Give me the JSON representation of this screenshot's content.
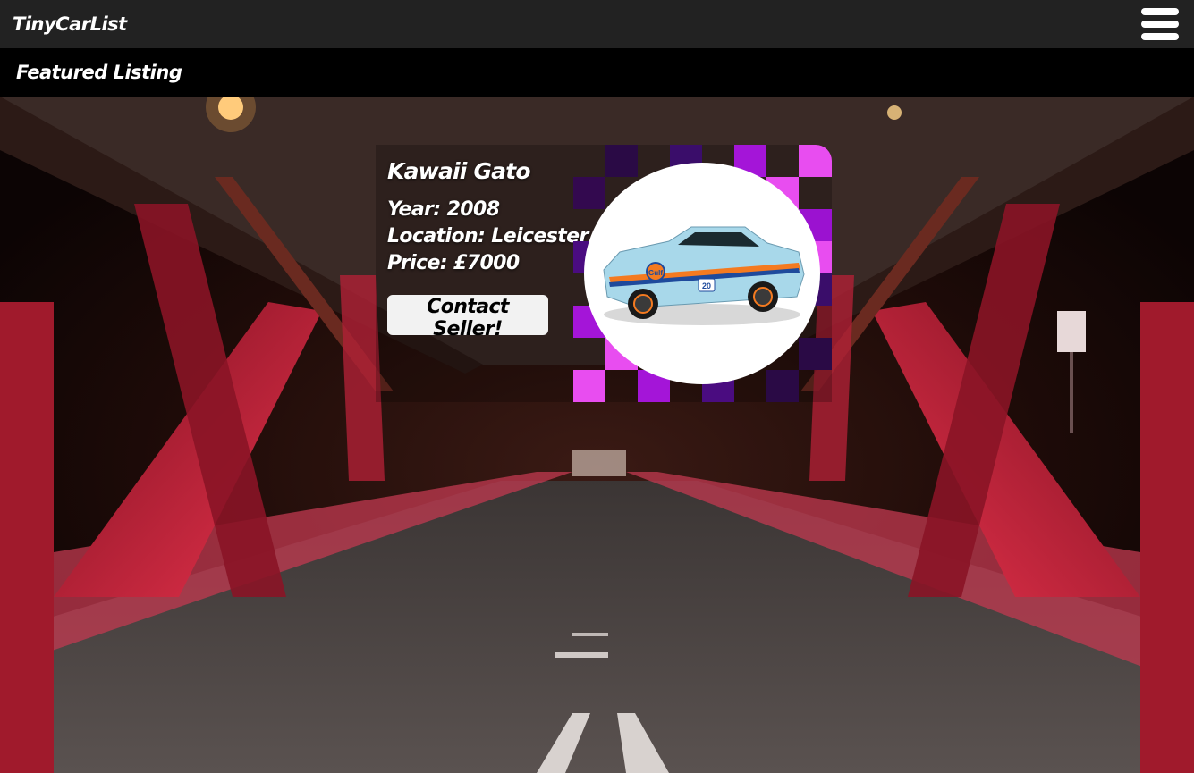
{
  "header": {
    "brand": "TinyCarList",
    "menu_icon": "hamburger-menu-icon"
  },
  "section": {
    "title": "Featured Listing"
  },
  "listing": {
    "name": "Kawaii Gato",
    "year_line": "Year: 2008",
    "location_line": "Location: Leicester",
    "price_line": "Price: £7000",
    "contact_label": "Contact Seller!",
    "car_decal_text": "Gulf",
    "car_number": "20",
    "image_icon": "toy-car-image"
  },
  "colors": {
    "topbar": "#222222",
    "section_header": "#000000",
    "accent_magenta": "#e84df0",
    "accent_purple": "#8a0fc4",
    "accent_dark_purple": "#2a0a45",
    "car_body": "#a8d8ea",
    "car_stripe": "#f47a20"
  }
}
